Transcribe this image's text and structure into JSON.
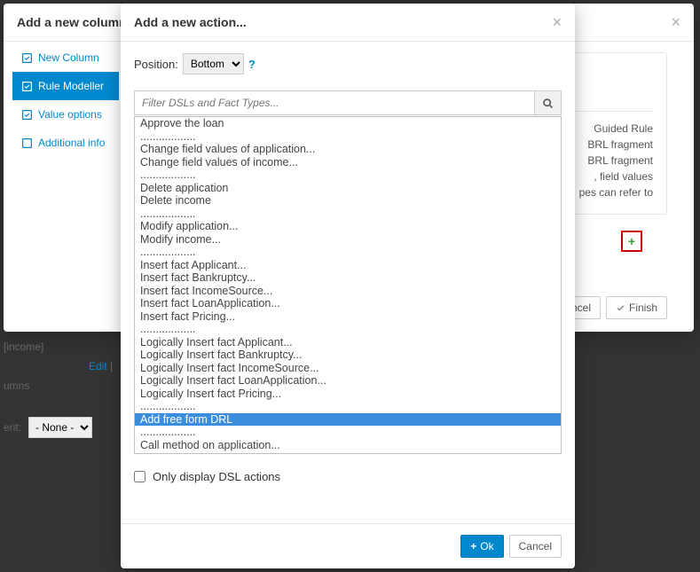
{
  "bg_modal": {
    "title": "Add a new column",
    "nav": [
      {
        "label": "New Column",
        "icon": "check-square"
      },
      {
        "label": "Rule Modeller",
        "icon": "check-square"
      },
      {
        "label": "Value options",
        "icon": "check-square"
      },
      {
        "label": "Additional info",
        "icon": "square"
      }
    ],
    "right_panel_text_1": "Guided Rule",
    "right_panel_text_2": "BRL fragment",
    "right_panel_text_3": "BRL fragment",
    "right_panel_text_4": ", field values",
    "right_panel_text_5": "pes can refer to",
    "footer": {
      "cancel": "Cancel",
      "finish": "Finish"
    }
  },
  "underlay": {
    "income": "[income]",
    "edit": "Edit",
    "columns": "umns",
    "rit_label": "erit:",
    "none": "- None -"
  },
  "modal": {
    "title": "Add a new action...",
    "position_label": "Position:",
    "position_value": "Bottom",
    "filter_placeholder": "Filter DSLs and Fact Types...",
    "options": [
      "Approve the loan",
      "..................",
      "Change field values of application...",
      "Change field values of income...",
      "..................",
      "Delete application",
      "Delete income",
      "..................",
      "Modify application...",
      "Modify income...",
      "..................",
      "Insert fact Applicant...",
      "Insert fact Bankruptcy...",
      "Insert fact IncomeSource...",
      "Insert fact LoanApplication...",
      "Insert fact Pricing...",
      "..................",
      "Logically Insert fact Applicant...",
      "Logically Insert fact Bankruptcy...",
      "Logically Insert fact IncomeSource...",
      "Logically Insert fact LoanApplication...",
      "Logically Insert fact Pricing...",
      "..................",
      "Add free form DRL",
      "..................",
      "Call method on application..."
    ],
    "selected_index": 23,
    "dsl_checkbox_label": "Only display DSL actions",
    "footer": {
      "ok": "Ok",
      "cancel": "Cancel"
    }
  }
}
